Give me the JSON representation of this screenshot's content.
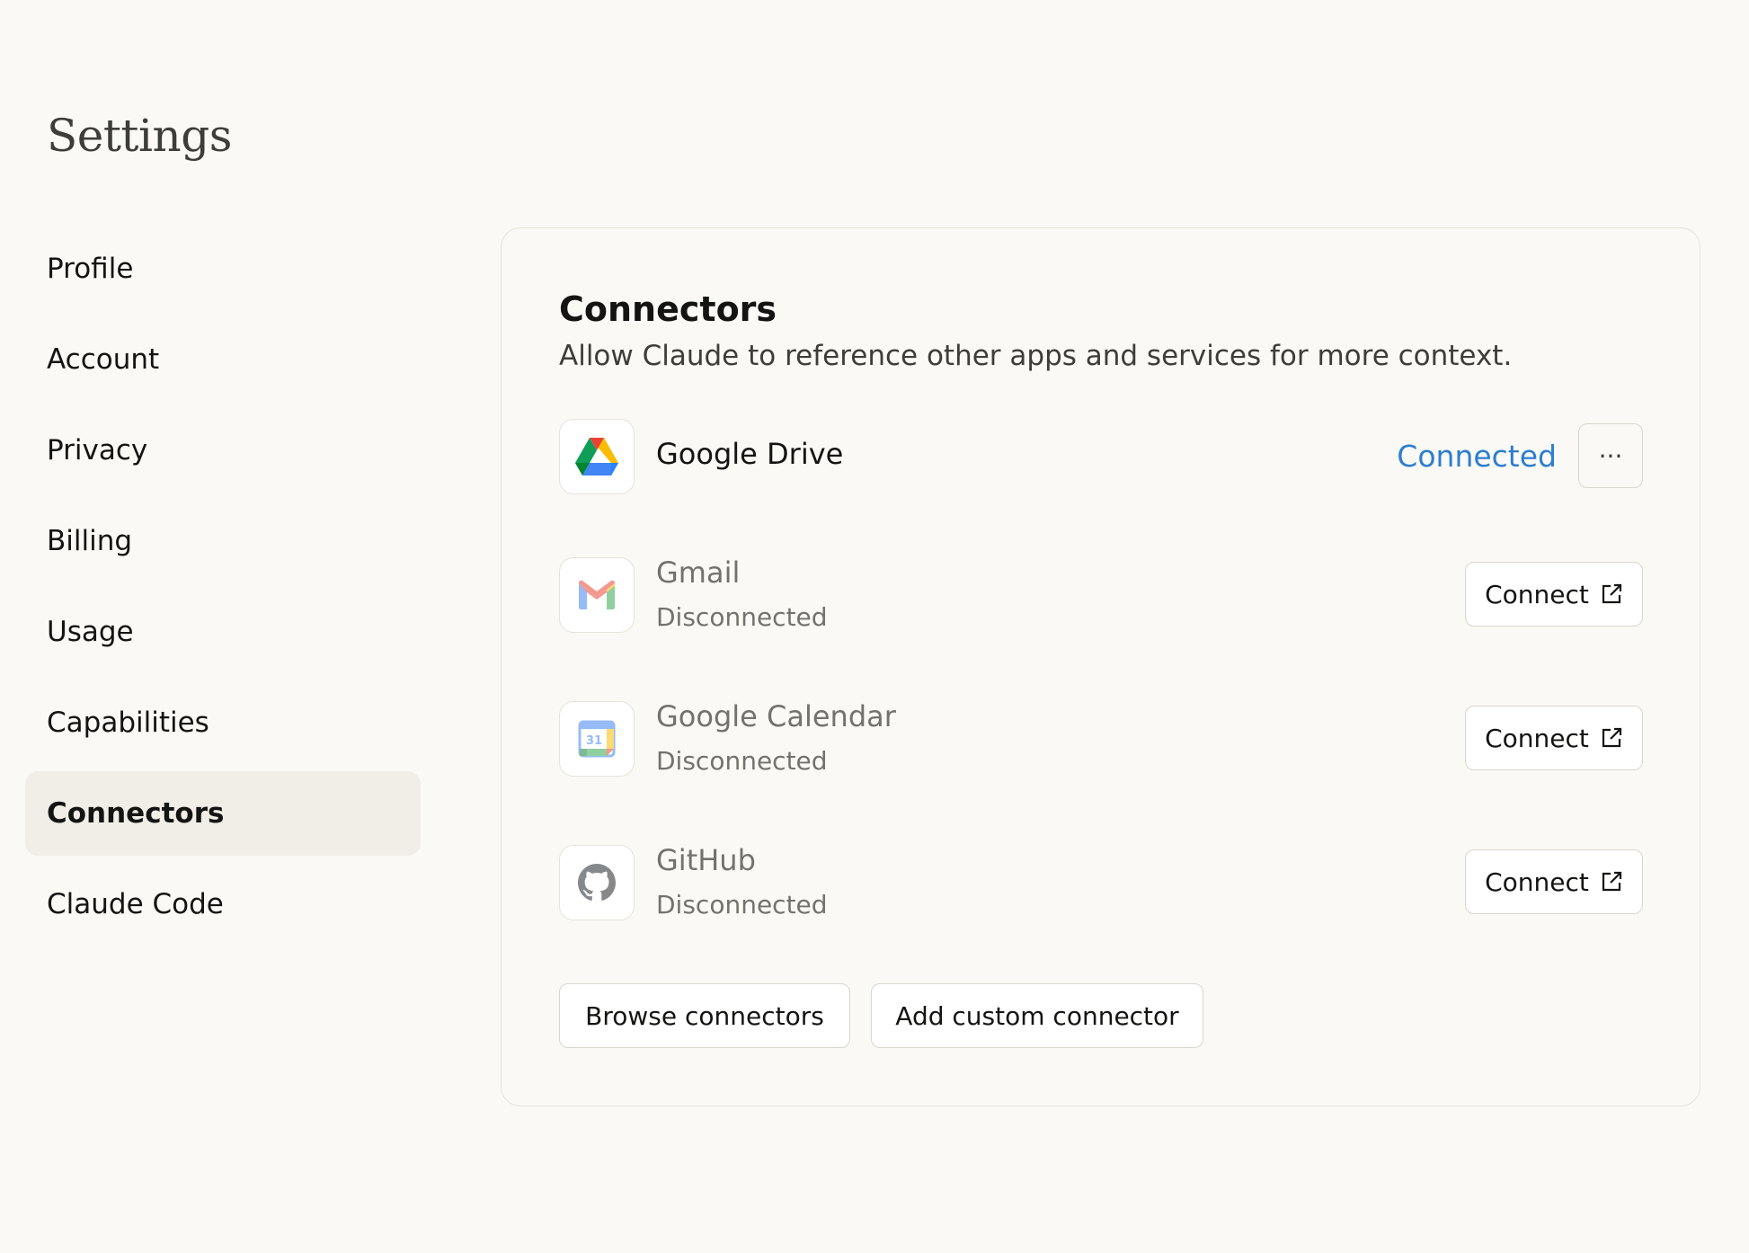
{
  "page": {
    "title": "Settings"
  },
  "sidebar": {
    "items": [
      {
        "label": "Profile",
        "active": false
      },
      {
        "label": "Account",
        "active": false
      },
      {
        "label": "Privacy",
        "active": false
      },
      {
        "label": "Billing",
        "active": false
      },
      {
        "label": "Usage",
        "active": false
      },
      {
        "label": "Capabilities",
        "active": false
      },
      {
        "label": "Connectors",
        "active": true
      },
      {
        "label": "Claude Code",
        "active": false
      }
    ]
  },
  "connectors": {
    "title": "Connectors",
    "subtitle": "Allow Claude to reference other apps and services for more context.",
    "items": [
      {
        "name": "Google Drive",
        "icon": "google-drive-icon",
        "status": "Connected",
        "status_color": "#2d7dd2",
        "action": "···"
      },
      {
        "name": "Gmail",
        "icon": "gmail-icon",
        "status": "Disconnected",
        "action": "Connect"
      },
      {
        "name": "Google Calendar",
        "icon": "google-calendar-icon",
        "status": "Disconnected",
        "action": "Connect",
        "icon_text": "31"
      },
      {
        "name": "GitHub",
        "icon": "github-icon",
        "status": "Disconnected",
        "action": "Connect"
      }
    ],
    "browse_label": "Browse connectors",
    "add_custom_label": "Add custom connector"
  }
}
